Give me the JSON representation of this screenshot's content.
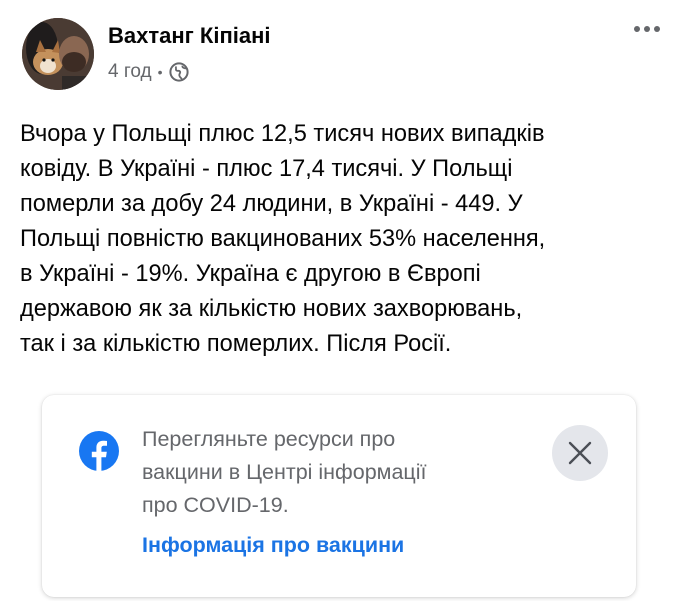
{
  "post": {
    "author": "Вахтанг Кіпіані",
    "time": "4 год",
    "separator": "•",
    "privacy_icon": "globe-icon",
    "more_icon": "more-options-icon",
    "text_lines": [
      "Вчора у Польщі плюс 12,5 тисяч нових випадків",
      "ковіду. В Україні - плюс 17,4 тисячі. У Польщі",
      "померли за добу 24 людини, в Україні - 449. У",
      "Польщі повністю вакцинованих 53% населення,",
      "в Україні - 19%. Україна є другою в Європі",
      "державою як за кількістю нових захворювань,",
      "так і за кількістю померлих. Після Росії."
    ]
  },
  "info_card": {
    "icon": "facebook-icon",
    "text_lines": [
      "Перегляньте ресурси про",
      "вакцини в Центрі інформації",
      "про COVID-19."
    ],
    "link": "Інформація про вакцини",
    "close_icon": "close-icon"
  },
  "colors": {
    "link_blue": "#1b74e4",
    "facebook_blue": "#1877f2",
    "secondary_text": "#65676b",
    "close_bg": "#e4e6eb"
  }
}
